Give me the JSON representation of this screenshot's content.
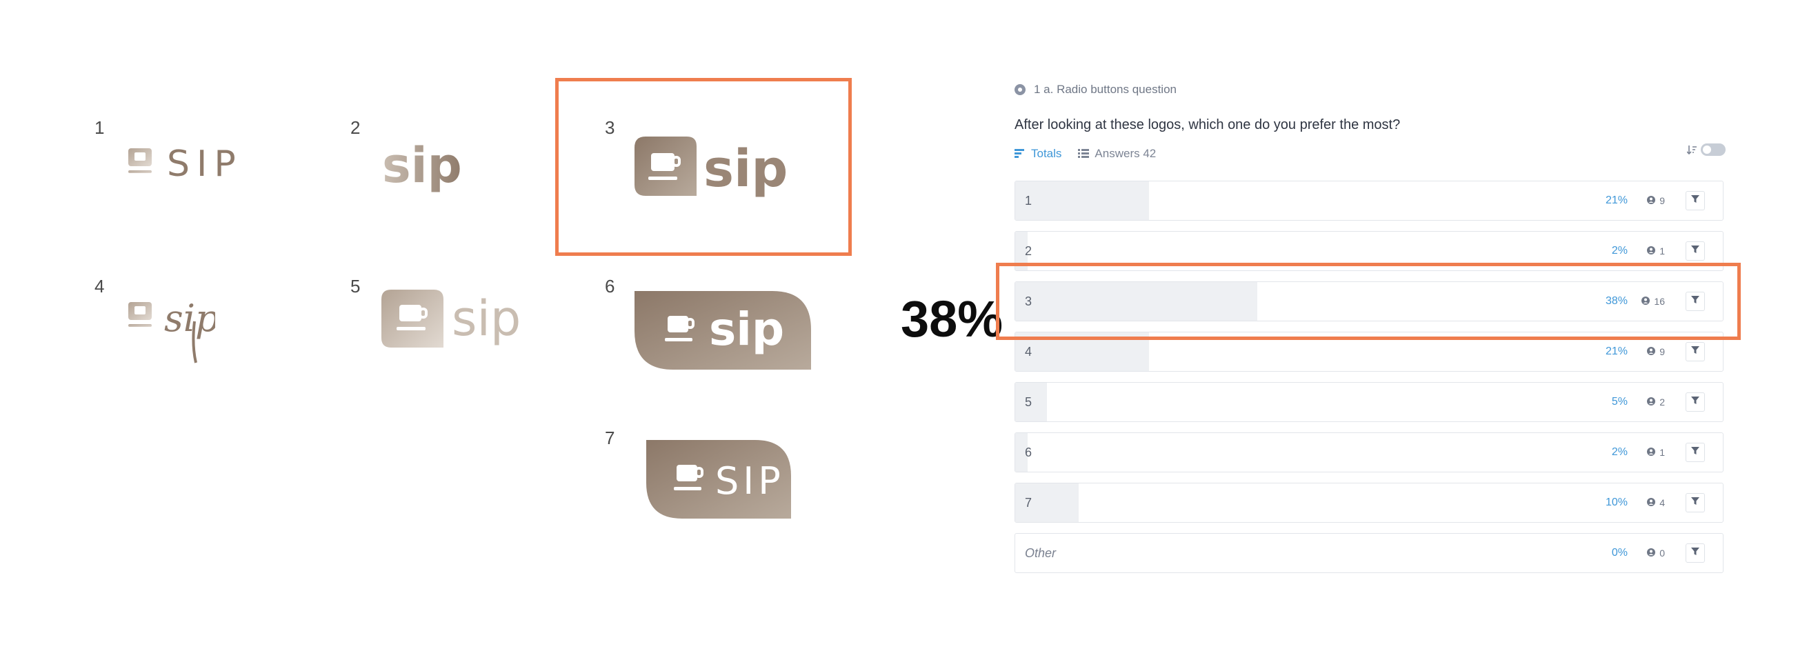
{
  "colors": {
    "accent": "#3f97d8",
    "highlight": "#ef7d4e",
    "logo_brown": "#9a8676"
  },
  "variants": [
    {
      "number": "1",
      "wordmark": "SIP"
    },
    {
      "number": "2",
      "wordmark": "sip"
    },
    {
      "number": "3",
      "wordmark": "sip"
    },
    {
      "number": "4",
      "wordmark": "sip"
    },
    {
      "number": "5",
      "wordmark": "sip"
    },
    {
      "number": "6",
      "wordmark": "sip"
    },
    {
      "number": "7",
      "wordmark": "SIP"
    }
  ],
  "callout": {
    "value": "38%"
  },
  "survey": {
    "question_meta": "1 a. Radio buttons question",
    "question_text": "After looking at these logos, which one do you prefer the most?",
    "tabs": {
      "totals": "Totals",
      "answers": "Answers 42"
    },
    "rows": [
      {
        "label": "1",
        "percent": "21%",
        "count": "9",
        "fraction": 0.21
      },
      {
        "label": "2",
        "percent": "2%",
        "count": "1",
        "fraction": 0.02
      },
      {
        "label": "3",
        "percent": "38%",
        "count": "16",
        "fraction": 0.38
      },
      {
        "label": "4",
        "percent": "21%",
        "count": "9",
        "fraction": 0.21
      },
      {
        "label": "5",
        "percent": "5%",
        "count": "2",
        "fraction": 0.05
      },
      {
        "label": "6",
        "percent": "2%",
        "count": "1",
        "fraction": 0.02
      },
      {
        "label": "7",
        "percent": "10%",
        "count": "4",
        "fraction": 0.1
      },
      {
        "label": "Other",
        "percent": "0%",
        "count": "0",
        "fraction": 0
      }
    ]
  }
}
